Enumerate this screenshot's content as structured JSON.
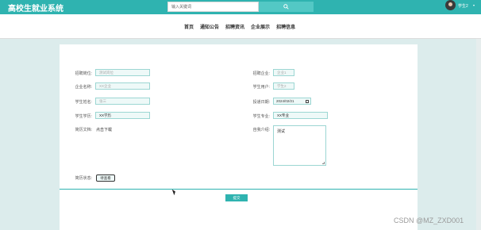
{
  "header": {
    "site_title": "高校生就业系统",
    "search_placeholder": "输入关键词",
    "search_button_icon": "search-icon",
    "user_name": "学生2",
    "user_caret": "▾"
  },
  "nav": {
    "items": [
      "首页",
      "通知公告",
      "招聘资讯",
      "企业展示",
      "招聘信息"
    ]
  },
  "form": {
    "left": [
      {
        "label": "招聘岗位:",
        "placeholder": "测试岗位",
        "value": ""
      },
      {
        "label": "企业名称:",
        "placeholder": "XX企业",
        "value": ""
      },
      {
        "label": "学生姓名:",
        "placeholder": "张三",
        "value": ""
      },
      {
        "label": "学生学历:",
        "placeholder": "",
        "value": "XX学历"
      },
      {
        "label": "简历文档:",
        "text": "点击下载"
      }
    ],
    "right": [
      {
        "label": "招聘企业:",
        "placeholder": "企业1",
        "value": ""
      },
      {
        "label": "学生用户:",
        "placeholder": "学生2",
        "value": ""
      },
      {
        "label": "投递日期:",
        "value": "2024/02/21"
      },
      {
        "label": "学生专业:",
        "placeholder": "",
        "value": "XX专业"
      },
      {
        "label": "自我介绍:",
        "value": "测试"
      }
    ],
    "status_label": "简历状态:",
    "status_value": "待查看",
    "submit_label": "提交"
  },
  "watermark": "CSDN @MZ_ZXD001",
  "colors": {
    "accent": "#2fb3b0",
    "page_bg": "#dcecec"
  }
}
